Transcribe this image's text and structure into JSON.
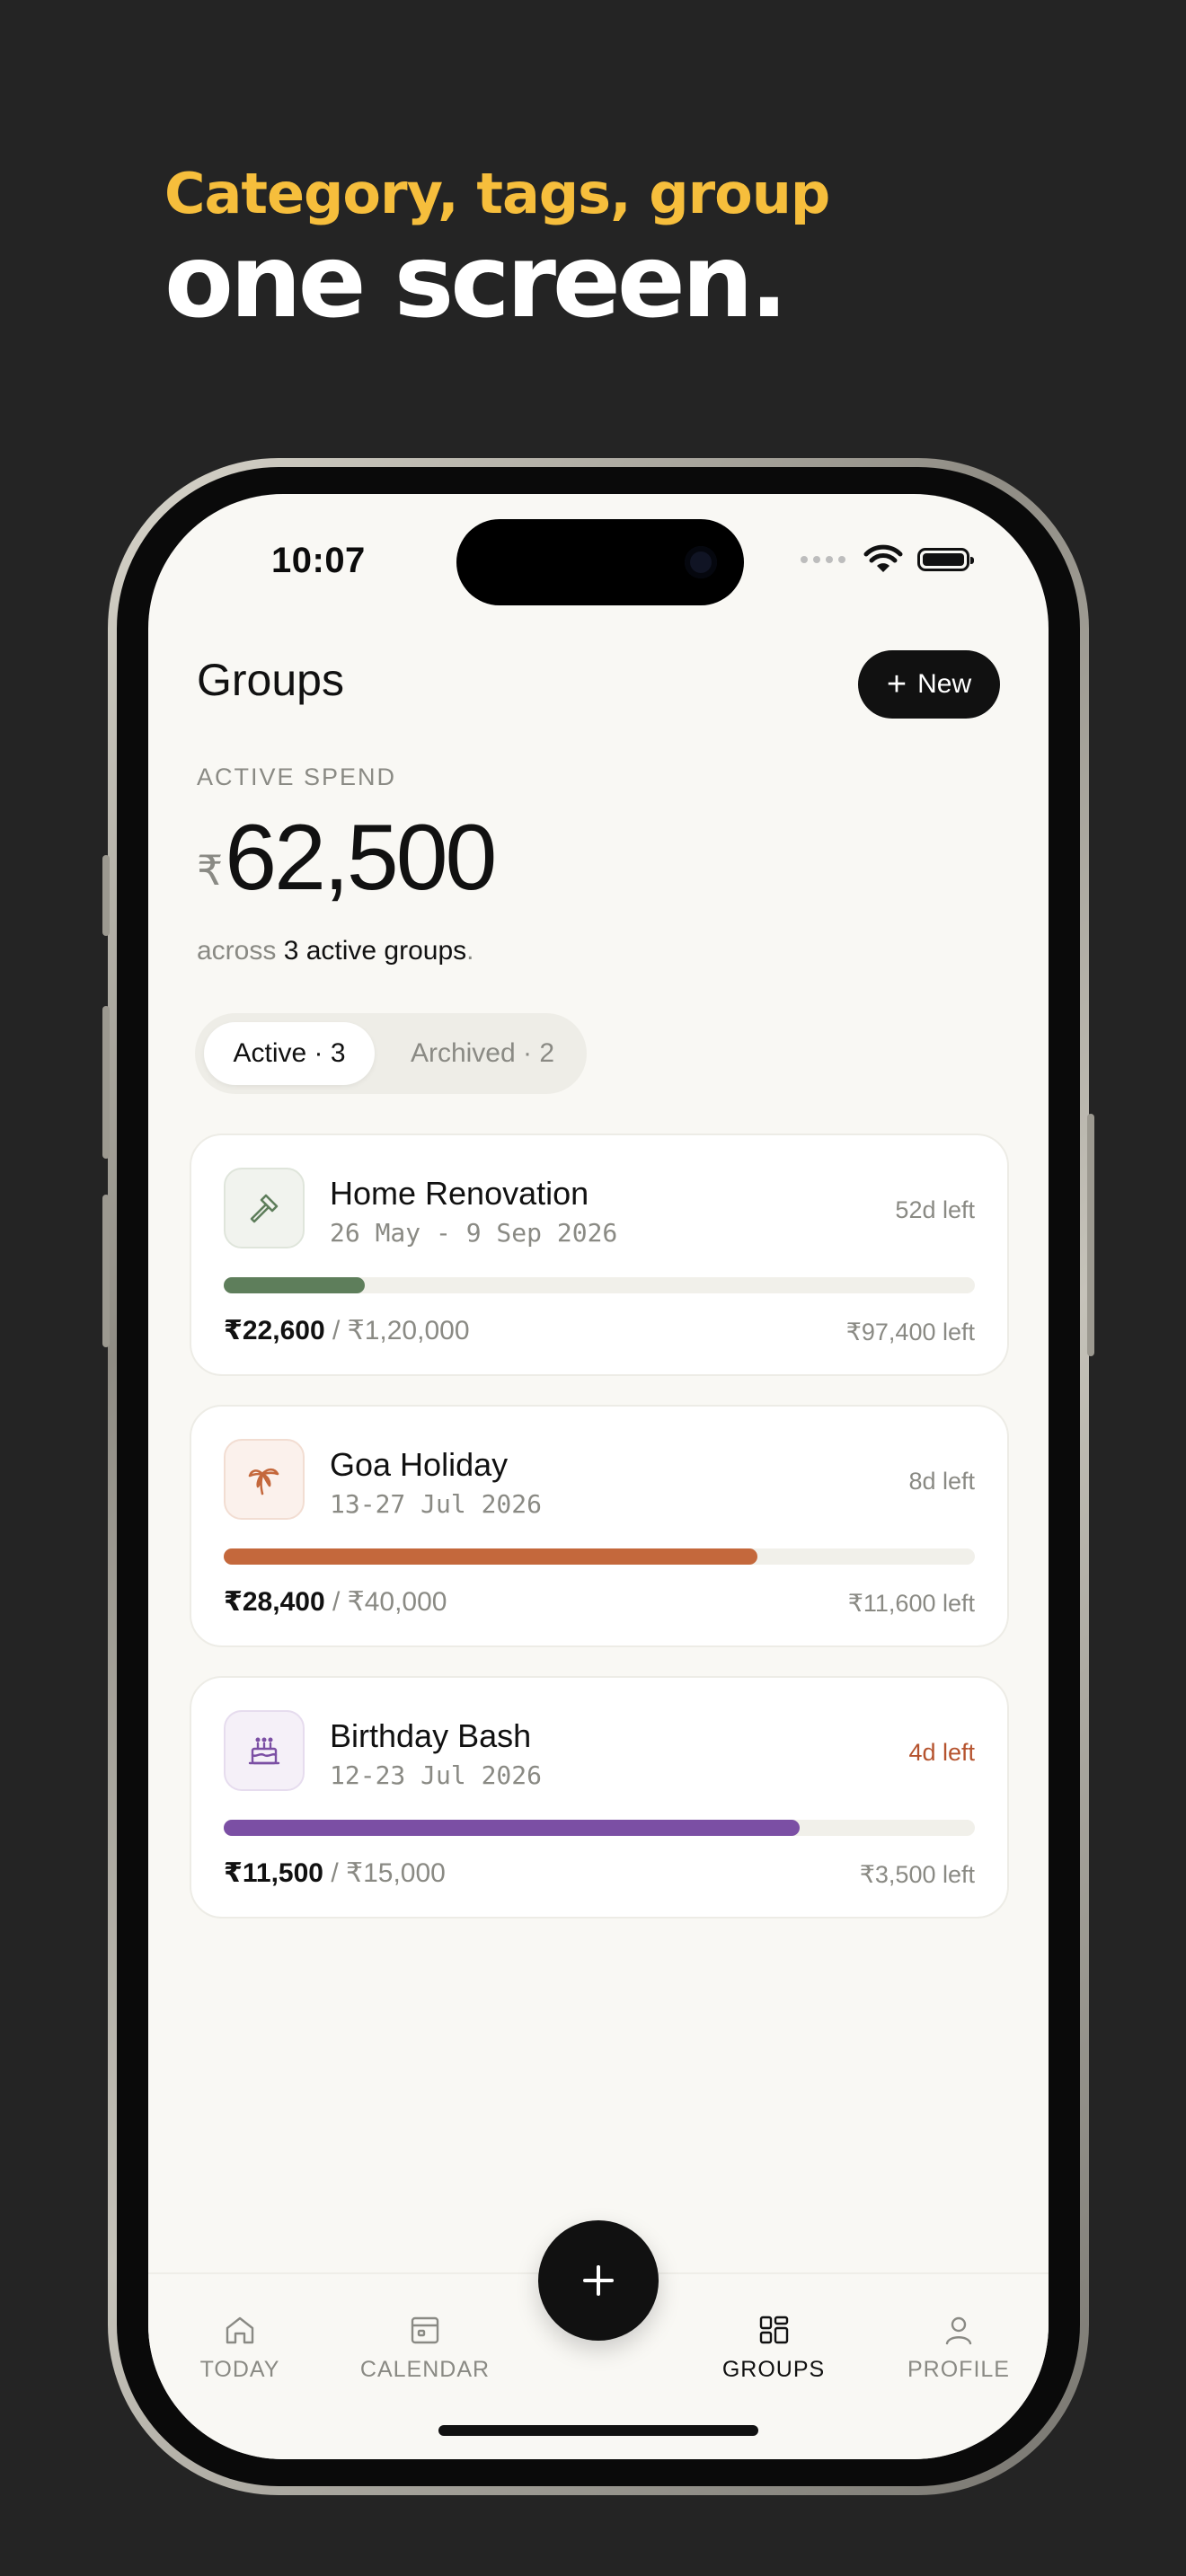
{
  "headline": {
    "line1": "Category, tags, group",
    "line2": "one screen."
  },
  "status": {
    "time": "10:07"
  },
  "header": {
    "title": "Groups",
    "new_label": "New"
  },
  "spend": {
    "label": "ACTIVE SPEND",
    "currency": "₹",
    "amount": "62,500",
    "sub_prefix": "across ",
    "sub_strong": "3 active groups",
    "sub_suffix": "."
  },
  "segments": {
    "active": "Active · 3",
    "archived": "Archived · 2"
  },
  "groups": [
    {
      "name": "Home Renovation",
      "dates": "26 May - 9 Sep 2026",
      "time_left": "52d left",
      "spent": "₹22,600",
      "budget": " / ₹1,20,000",
      "remaining": "₹97,400 left",
      "progress": 0.188,
      "color": "#5E7E5B",
      "icon": "hammer-icon"
    },
    {
      "name": "Goa Holiday",
      "dates": "13-27 Jul 2026",
      "time_left": "8d left",
      "spent": "₹28,400",
      "budget": " / ₹40,000",
      "remaining": "₹11,600 left",
      "progress": 0.71,
      "color": "#C4683C",
      "icon": "palm-tree-icon"
    },
    {
      "name": "Birthday Bash",
      "dates": "12-23 Jul 2026",
      "time_left": "4d left",
      "spent": "₹11,500",
      "budget": " / ₹15,000",
      "remaining": "₹3,500 left",
      "progress": 0.767,
      "color": "#7B4FA4",
      "icon": "cake-icon"
    }
  ],
  "nav": {
    "today": "TODAY",
    "calendar": "CALENDAR",
    "groups": "GROUPS",
    "profile": "PROFILE"
  }
}
